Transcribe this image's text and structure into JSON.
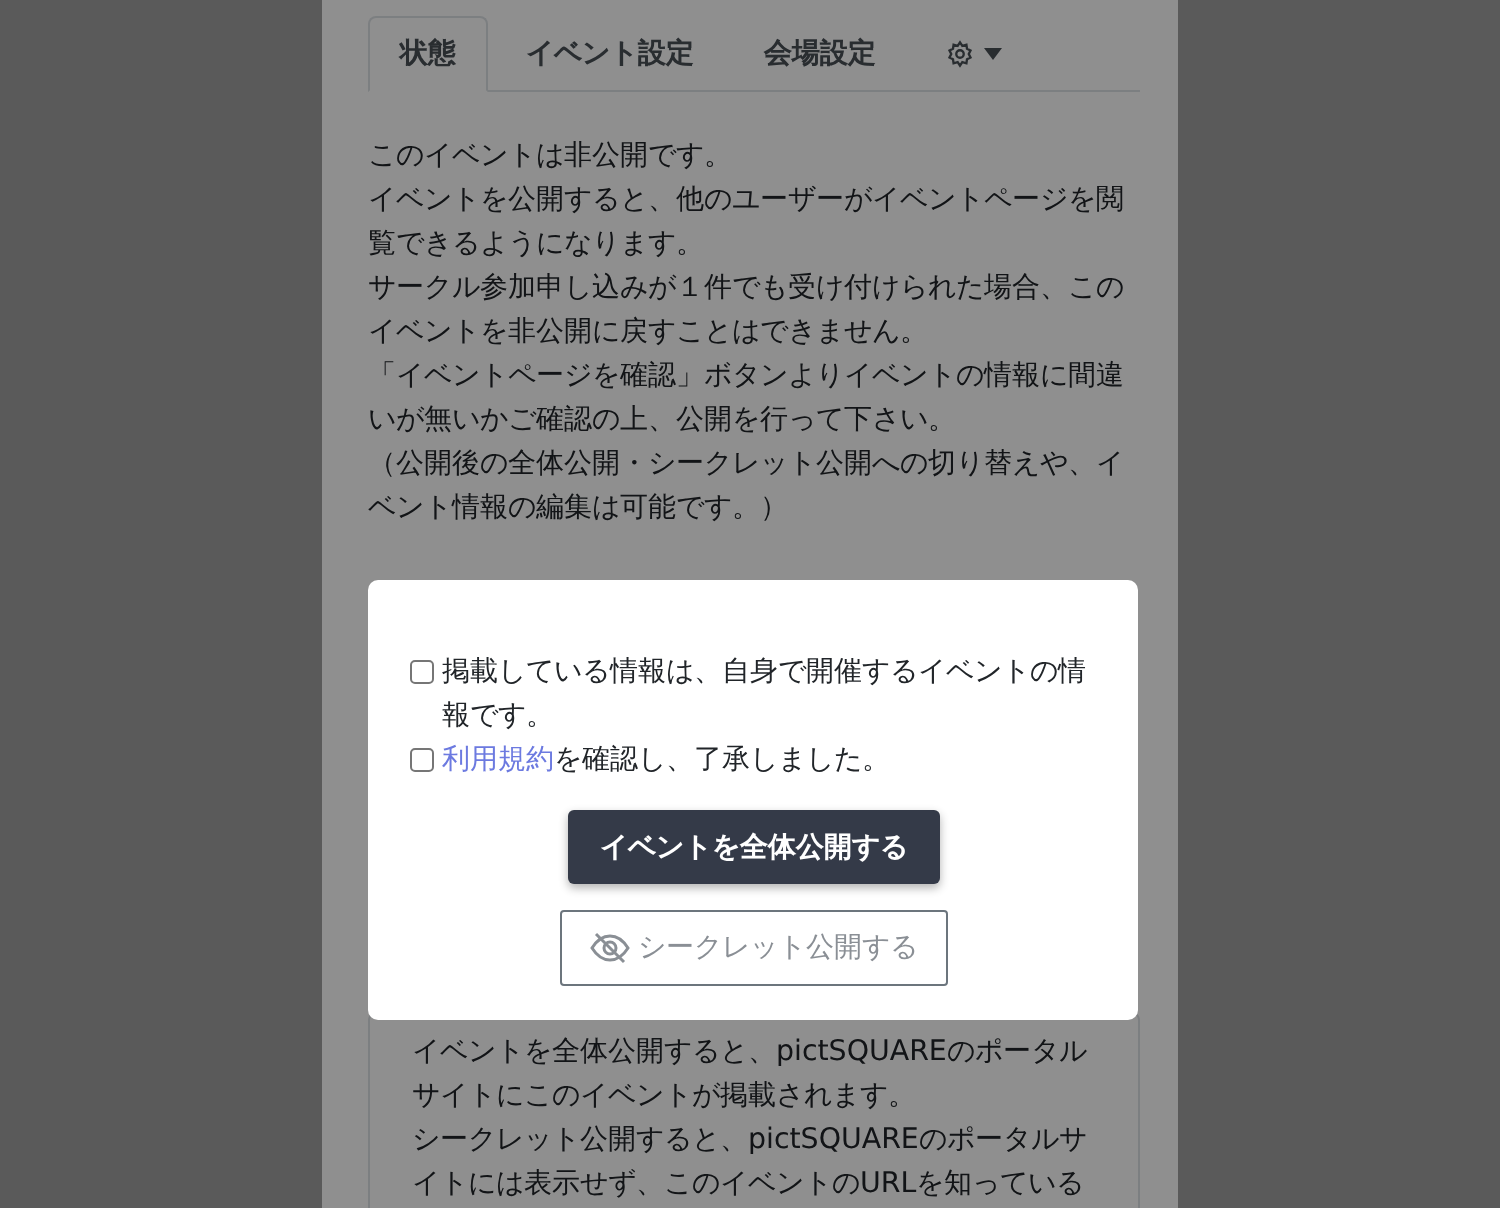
{
  "tabs": [
    {
      "kind": "text",
      "label": "状態",
      "selected": true
    },
    {
      "kind": "text",
      "label": "イベント設定",
      "selected": false
    },
    {
      "kind": "text",
      "label": "会場設定",
      "selected": false
    },
    {
      "kind": "settings_menu",
      "selected": false
    }
  ],
  "status_text": [
    "このイベントは非公開です。",
    "イベントを公開すると、他のユーザーがイベントページを閲覧できるようになります。",
    "サークル参加申し込みが１件でも受け付けられた場合、このイベントを非公開に戻すことはできません。",
    "「イベントページを確認」ボタンよりイベントの情報に間違いが無いかご確認の上、公開を行って下さい。",
    "（公開後の全体公開・シークレット公開への切り替えや、イベント情報の編集は可能です。）"
  ],
  "info_card": [
    "イベントを全体公開すると、pictSQUAREのポータルサイトにこのイベントが掲載されます。",
    "シークレット公開すると、pictSQUAREのポータルサイトには表示せず、このイベントのURLを知っている"
  ],
  "dialog": {
    "checkboxes": [
      {
        "text": "掲載している情報は、自身で開催するイベントの情報です。",
        "checked": false
      },
      {
        "link": "利用規約",
        "text": "を確認し、了承しました。",
        "checked": false
      }
    ],
    "primary_button": {
      "label": "イベントを全体公開する",
      "disabled": false
    },
    "secondary_button": {
      "label": "シークレット公開する",
      "disabled": true
    }
  }
}
